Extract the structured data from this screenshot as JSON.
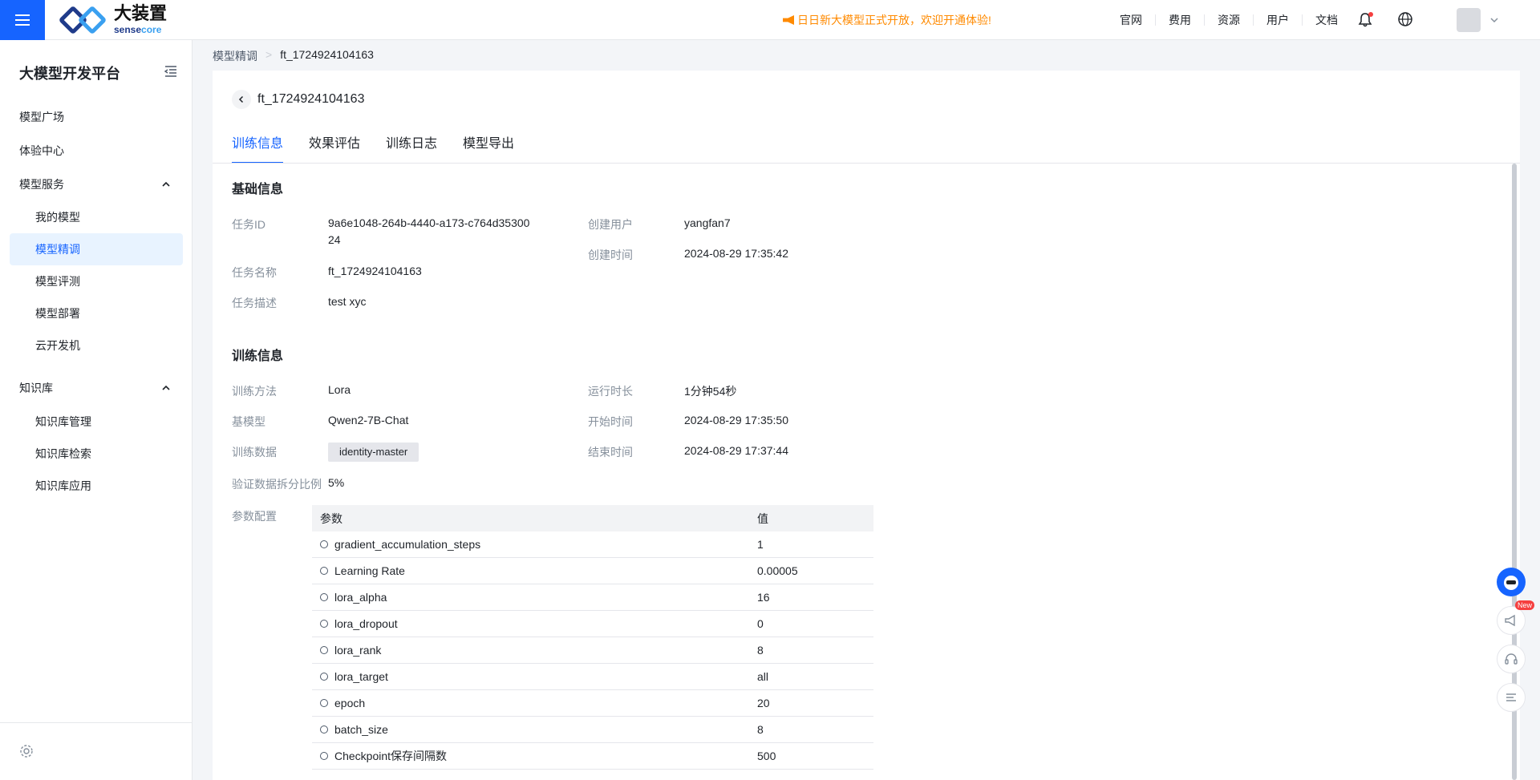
{
  "header": {
    "logo_cn": "大装置",
    "logo_en_a": "sense",
    "logo_en_b": "core",
    "announcement": "日日新大模型正式开放，欢迎开通体验!",
    "nav": [
      "官网",
      "费用",
      "资源",
      "用户",
      "文档"
    ],
    "accent": "#1664ff",
    "announce_color": "#ff8a00"
  },
  "sidebar": {
    "title": "大模型开发平台",
    "items": [
      {
        "label": "模型广场"
      },
      {
        "label": "体验中心"
      },
      {
        "label": "模型服务"
      },
      {
        "label": "我的模型"
      },
      {
        "label": "模型精调"
      },
      {
        "label": "模型评测"
      },
      {
        "label": "模型部署"
      },
      {
        "label": "云开发机"
      },
      {
        "label": "知识库"
      },
      {
        "label": "知识库管理"
      },
      {
        "label": "知识库检索"
      },
      {
        "label": "知识库应用"
      }
    ]
  },
  "breadcrumb": {
    "parent": "模型精调",
    "sep": ">",
    "current": "ft_1724924104163"
  },
  "page": {
    "title": "ft_1724924104163",
    "tabs": [
      "训练信息",
      "效果评估",
      "训练日志",
      "模型导出"
    ]
  },
  "basic": {
    "title": "基础信息",
    "task_id_label": "任务ID",
    "task_id_line1": "9a6e1048-264b-4440-a173-c764d35300",
    "task_id_line2": "24",
    "task_name_label": "任务名称",
    "task_name": "ft_1724924104163",
    "task_desc_label": "任务描述",
    "task_desc": "test xyc",
    "creator_label": "创建用户",
    "creator": "yangfan7",
    "created_label": "创建时间",
    "created": "2024-08-29 17:35:42"
  },
  "training": {
    "title": "训练信息",
    "method_label": "训练方法",
    "method": "Lora",
    "base_label": "基模型",
    "base": "Qwen2-7B-Chat",
    "data_label": "训练数据",
    "data": "identity-master",
    "split_label": "验证数据拆分比例",
    "split": "5%",
    "runtime_label": "运行时长",
    "runtime": "1分钟54秒",
    "start_label": "开始时间",
    "start": "2024-08-29 17:35:50",
    "end_label": "结束时间",
    "end": "2024-08-29 17:37:44",
    "params_label": "参数配置",
    "table_header": {
      "param": "参数",
      "value": "值"
    },
    "params": [
      {
        "name": "gradient_accumulation_steps",
        "value": "1"
      },
      {
        "name": "Learning Rate",
        "value": "0.00005"
      },
      {
        "name": "lora_alpha",
        "value": "16"
      },
      {
        "name": "lora_dropout",
        "value": "0"
      },
      {
        "name": "lora_rank",
        "value": "8"
      },
      {
        "name": "lora_target",
        "value": "all"
      },
      {
        "name": "epoch",
        "value": "20"
      },
      {
        "name": "batch_size",
        "value": "8"
      },
      {
        "name": "Checkpoint保存间隔数",
        "value": "500"
      }
    ]
  },
  "float_tools": {
    "new_badge": "New"
  }
}
